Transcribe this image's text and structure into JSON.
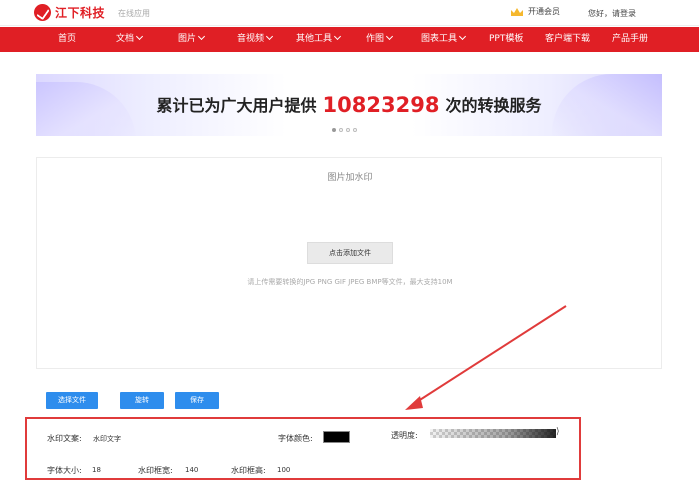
{
  "header": {
    "brand": "江下科技",
    "brand_sub": "在线应用",
    "vip_label": "开通会员",
    "login_label": "您好，请登录"
  },
  "nav": {
    "items": [
      {
        "label": "首页",
        "dropdown": false
      },
      {
        "label": "文档",
        "dropdown": true
      },
      {
        "label": "图片",
        "dropdown": true
      },
      {
        "label": "音视频",
        "dropdown": true
      },
      {
        "label": "其他工具",
        "dropdown": true
      },
      {
        "label": "作图",
        "dropdown": true
      },
      {
        "label": "图表工具",
        "dropdown": true
      },
      {
        "label": "PPT模板",
        "dropdown": false
      },
      {
        "label": "客户端下载",
        "dropdown": false
      },
      {
        "label": "产品手册",
        "dropdown": false
      }
    ]
  },
  "banner": {
    "prefix": "累计已为广大用户提供",
    "count": "10823298",
    "suffix": "次的转换服务"
  },
  "upload": {
    "title": "图片加水印",
    "button": "点击添加文件",
    "hint": "请上传需要转换的JPG PNG GIF JPEG BMP等文件，最大支持10M"
  },
  "actions": {
    "select": "选择文件",
    "rotate": "旋转",
    "save": "保存"
  },
  "settings": {
    "text_label": "水印文案:",
    "text_value": "水印文字",
    "color_label": "字体颜色:",
    "color_value": "#000000",
    "opacity_label": "透明度:",
    "size_label": "字体大小:",
    "size_value": "18",
    "width_label": "水印框宽:",
    "width_value": "140",
    "height_label": "水印框高:",
    "height_value": "100"
  },
  "colors": {
    "brand_red": "#e01f25",
    "button_blue": "#2e8ded",
    "highlight_red": "#e03b3b"
  }
}
